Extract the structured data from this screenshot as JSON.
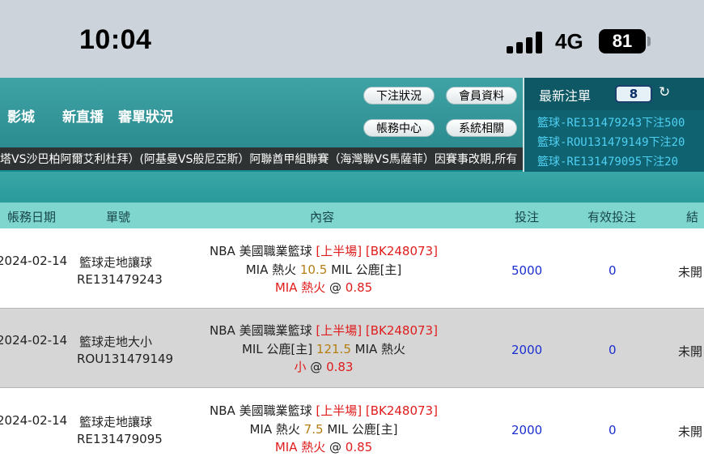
{
  "status_bar": {
    "time": "10:04",
    "network": "4G",
    "battery": "81"
  },
  "nav": {
    "partial_item": "影城",
    "live": "新直播",
    "bet_review": "審單狀況"
  },
  "buttons": {
    "bet_status": "下注狀況",
    "member_info": "會員資料",
    "account_center": "帳務中心",
    "system": "系統相關"
  },
  "ticker": "塔VS沙巴柏阿爾艾利杜拜）(阿基曼VS般尼亞斯）阿聯酋甲組聯賽（海灣聯VS馬薩菲）因賽事改期,所有",
  "latest": {
    "title": "最新注單",
    "count": "8",
    "items": [
      "籃球-RE131479243下注500",
      "籃球-ROU131479149下注20",
      "籃球-RE131479095下注20"
    ]
  },
  "table": {
    "headers": {
      "date": "帳務日期",
      "ticket": "單號",
      "content": "內容",
      "stake": "投注",
      "valid": "有效投注",
      "result": "結果"
    },
    "rows": [
      {
        "date": "2024-02-14",
        "type": "籃球走地讓球",
        "ticket": "RE131479243",
        "league": "NBA 美國職業籃球",
        "period": "[上半場]",
        "code": "[BK248073]",
        "team_a": "MIA 熱火",
        "line": "10.5",
        "team_b": "MIL 公鹿[主]",
        "pick": "MIA 熱火",
        "at": "@",
        "odds": "0.85",
        "stake": "5000",
        "valid": "0",
        "result": "未開"
      },
      {
        "date": "2024-02-14",
        "type": "籃球走地大小",
        "ticket": "ROU131479149",
        "league": "NBA 美國職業籃球",
        "period": "[上半場]",
        "code": "[BK248073]",
        "team_a": "MIL 公鹿[主]",
        "line": "121.5",
        "team_b": "MIA 熱火",
        "pick": "小",
        "at": "@",
        "odds": "0.83",
        "stake": "2000",
        "valid": "0",
        "result": "未開"
      },
      {
        "date": "2024-02-14",
        "type": "籃球走地讓球",
        "ticket": "RE131479095",
        "league": "NBA 美國職業籃球",
        "period": "[上半場]",
        "code": "[BK248073]",
        "team_a": "MIA 熱火",
        "line": "7.5",
        "team_b": "MIL 公鹿[主]",
        "pick": "MIA 熱火",
        "at": "@",
        "odds": "0.85",
        "stake": "2000",
        "valid": "0",
        "result": "未開"
      }
    ]
  },
  "colors": {
    "teal": "#2c8c90",
    "header_row": "#7fd6cf",
    "red": "#e01c1c",
    "gold": "#b47e12",
    "blue": "#1b2fd0",
    "latest_link": "#4fd0f3"
  }
}
